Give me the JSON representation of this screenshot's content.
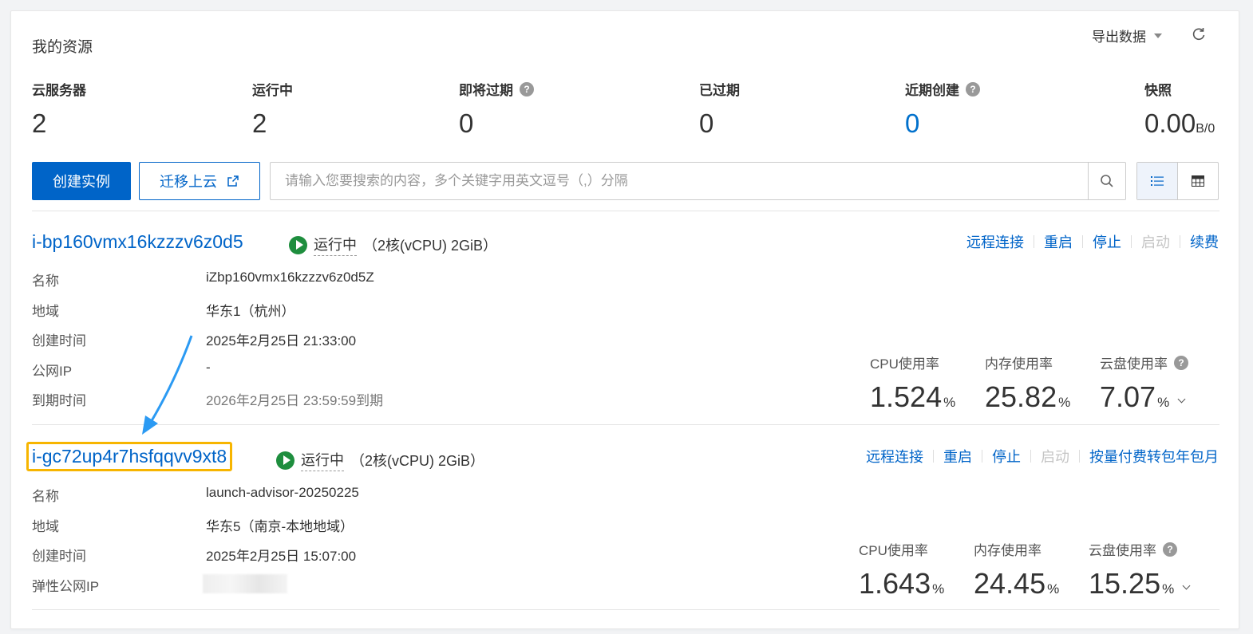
{
  "header": {
    "title": "我的资源",
    "export_label": "导出数据",
    "refresh_icon": "refresh-icon"
  },
  "stats": [
    {
      "label": "云服务器",
      "value": "2",
      "help": false
    },
    {
      "label": "运行中",
      "value": "2",
      "help": false
    },
    {
      "label": "即将过期",
      "value": "0",
      "help": true
    },
    {
      "label": "已过期",
      "value": "0",
      "help": false
    },
    {
      "label": "近期创建",
      "value": "0",
      "help": true
    },
    {
      "label": "快照",
      "value": "0.00",
      "unit": "B/0",
      "help": false
    }
  ],
  "toolbar": {
    "create_label": "创建实例",
    "migrate_label": "迁移上云",
    "search_placeholder": "请输入您要搜索的内容，多个关键字用英文逗号（,）分隔",
    "search_value": ""
  },
  "instances": [
    {
      "id": "i-bp160vmx16kzzzv6z0d5",
      "status": "运行中",
      "spec": "（2核(vCPU) 2GiB）",
      "actions": [
        "远程连接",
        "重启",
        "停止",
        "启动",
        "续费"
      ],
      "fields": [
        {
          "label": "名称",
          "value": "iZbp160vmx16kzzzv6z0d5Z"
        },
        {
          "label": "地域",
          "value": "华东1（杭州）"
        },
        {
          "label": "创建时间",
          "value": "2025年2月25日 21:33:00"
        },
        {
          "label": "公网IP",
          "value": "-"
        },
        {
          "label": "到期时间",
          "value": "2026年2月25日 23:59:59到期"
        }
      ],
      "metrics": [
        {
          "label": "CPU使用率",
          "value": "1.524",
          "unit": "%"
        },
        {
          "label": "内存使用率",
          "value": "25.82",
          "unit": "%"
        },
        {
          "label": "云盘使用率",
          "value": "7.07",
          "unit": "%"
        }
      ]
    },
    {
      "id": "i-gc72up4r7hsfqqvv9xt8",
      "status": "运行中",
      "spec": "（2核(vCPU) 2GiB）",
      "actions": [
        "远程连接",
        "重启",
        "停止",
        "启动",
        "按量付费转包年包月"
      ],
      "fields": [
        {
          "label": "名称",
          "value": "launch-advisor-20250225"
        },
        {
          "label": "地域",
          "value": "华东5（南京-本地地域）"
        },
        {
          "label": "创建时间",
          "value": "2025年2月25日 15:07:00"
        },
        {
          "label": "弹性公网IP",
          "value": ""
        }
      ],
      "metrics": [
        {
          "label": "CPU使用率",
          "value": "1.643",
          "unit": "%"
        },
        {
          "label": "内存使用率",
          "value": "24.45",
          "unit": "%"
        },
        {
          "label": "云盘使用率",
          "value": "15.25",
          "unit": "%"
        }
      ]
    }
  ],
  "colors": {
    "primary": "#0064c8",
    "running": "#1e8e3e",
    "highlight": "#f7b500",
    "annotation_arrow": "#2b9af3"
  }
}
